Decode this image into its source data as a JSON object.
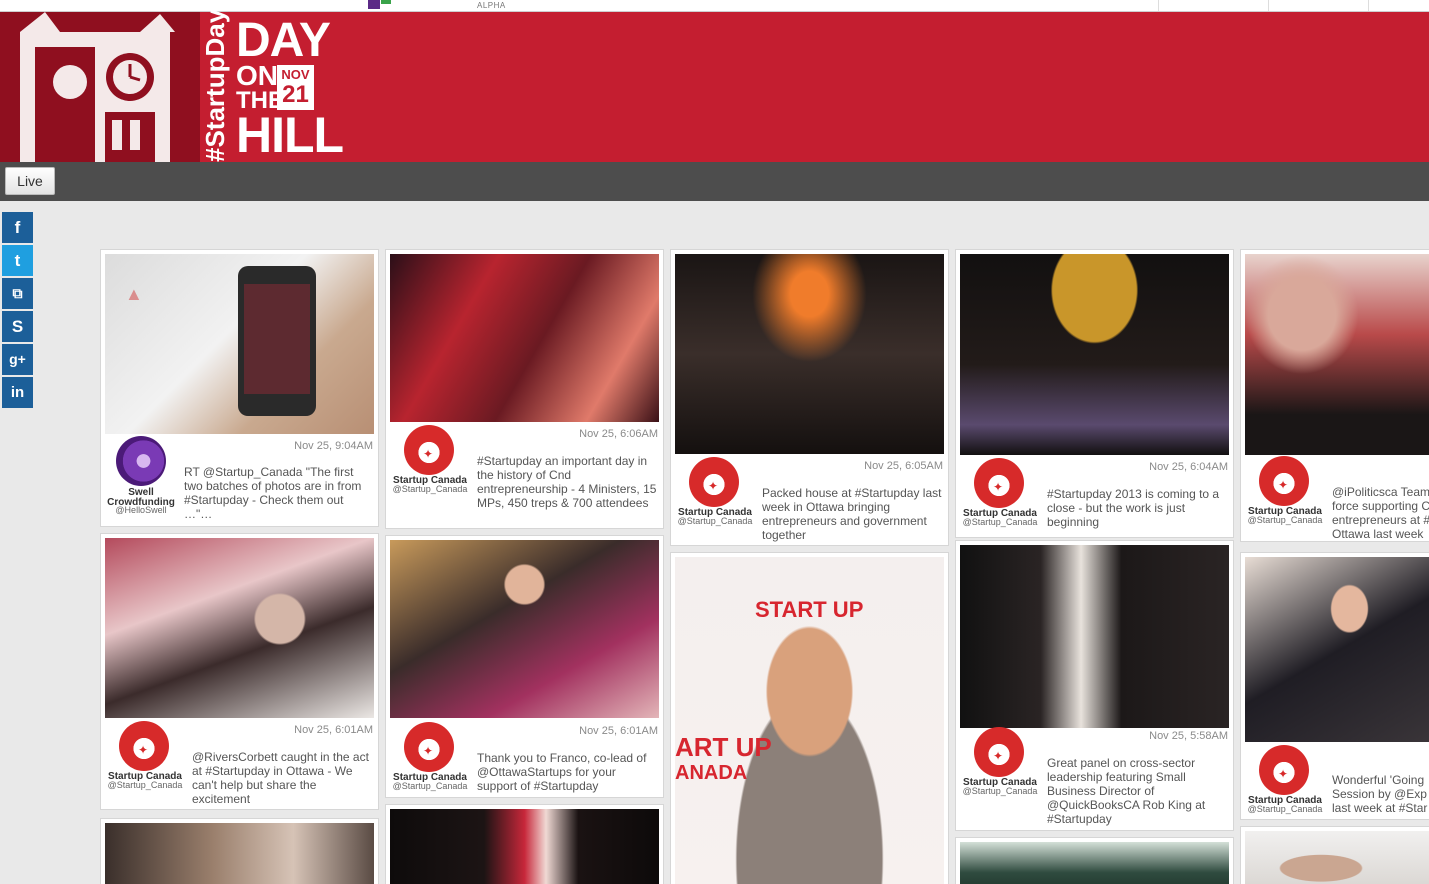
{
  "topbar": {
    "alpha_label": "ALPHA"
  },
  "banner": {
    "hashtag": "#StartupDay",
    "title_day": "DAY",
    "title_on": "ON",
    "title_the": "THE",
    "title_hill": "HILL",
    "date_month": "NOV",
    "date_day": "21",
    "color": "#c41e30"
  },
  "nav": {
    "live_label": "Live"
  },
  "share": [
    {
      "name": "facebook-icon",
      "glyph": "f"
    },
    {
      "name": "twitter-icon",
      "glyph": "t"
    },
    {
      "name": "delicious-icon",
      "glyph": "⧉"
    },
    {
      "name": "stumbleupon-icon",
      "glyph": "S"
    },
    {
      "name": "googleplus-icon",
      "glyph": "g+"
    },
    {
      "name": "linkedin-icon",
      "glyph": "in"
    }
  ],
  "cards": [
    {
      "ts": "Nov 25, 9:04AM",
      "name": "Swell Crowdfunding",
      "handle": "@HelloSwell",
      "text": "RT @Startup_Canada \"The first two batches of photos are in from #Startupday - Check them out …\"…",
      "avatar": "swell"
    },
    {
      "ts": "Nov 25, 6:06AM",
      "name": "Startup Canada",
      "handle": "@Startup_Canada",
      "text": "#Startupday an important day in the history of Cnd entrepreneurship - 4 Ministers, 15 MPs, 450 treps & 700 attendees",
      "avatar": "sc"
    },
    {
      "ts": "Nov 25, 6:05AM",
      "name": "Startup Canada",
      "handle": "@Startup_Canada",
      "text": "Packed house at #Startupday last week in Ottawa bringing entrepreneurs and government together",
      "avatar": "sc"
    },
    {
      "ts": "Nov 25, 6:04AM",
      "name": "Startup Canada",
      "handle": "@Startup_Canada",
      "text": "#Startupday 2013 is coming to a close - but the work is just beginning",
      "avatar": "sc"
    },
    {
      "ts": "",
      "name": "Startup Canada",
      "handle": "@Startup_Canada",
      "text": "@iPoliticsca Team force supporting C entrepreneurs at # Ottawa last week",
      "avatar": "sc"
    },
    {
      "ts": "Nov 25, 6:01AM",
      "name": "Startup Canada",
      "handle": "@Startup_Canada",
      "text": "@RiversCorbett caught in the act at #Startupday in Ottawa - We can't help but share the excitement",
      "avatar": "sc"
    },
    {
      "ts": "Nov 25, 6:01AM",
      "name": "Startup Canada",
      "handle": "@Startup_Canada",
      "text": "Thank you to Franco, co-lead of @OttawaStartups for your support of #Startupday",
      "avatar": "sc"
    },
    {
      "ts": "",
      "name": "",
      "handle": "",
      "text": "",
      "avatar": ""
    },
    {
      "ts": "Nov 25, 5:58AM",
      "name": "Startup Canada",
      "handle": "@Startup_Canada",
      "text": "Great panel on cross-sector leadership featuring Small Business Director of @QuickBooksCA Rob King at #Startupday",
      "avatar": "sc"
    },
    {
      "ts": "",
      "name": "Startup Canada",
      "handle": "@Startup_Canada",
      "text": "Wonderful 'Going Session by @Exp last week at #Star",
      "avatar": "sc"
    }
  ]
}
